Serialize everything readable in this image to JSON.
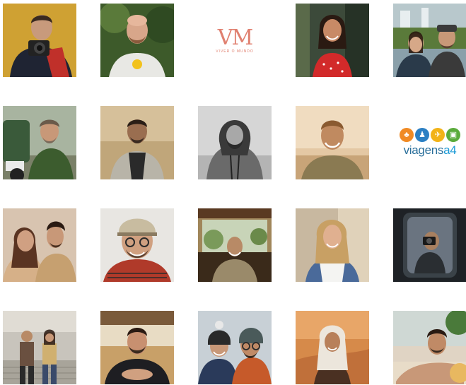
{
  "grid": {
    "tiles": [
      {
        "id": "r1c1",
        "kind": "photo",
        "subject": "photographer with camera"
      },
      {
        "id": "r1c2",
        "kind": "photo",
        "subject": "bald bearded man in white tee"
      },
      {
        "id": "r1c3",
        "kind": "logo",
        "mark": "VM",
        "tagline": "VIVER O MUNDO"
      },
      {
        "id": "r1c4",
        "kind": "photo",
        "subject": "woman in red polka dress"
      },
      {
        "id": "r1c5",
        "kind": "photo",
        "subject": "couple at waterfall"
      },
      {
        "id": "r2c1",
        "kind": "photo",
        "subject": "man on motorbike"
      },
      {
        "id": "r2c2",
        "kind": "photo",
        "subject": "man in grey hoodie"
      },
      {
        "id": "r2c3",
        "kind": "photo",
        "subject": "bearded man in hood, black and white"
      },
      {
        "id": "r2c4",
        "kind": "photo",
        "subject": "smiling man at sunset"
      },
      {
        "id": "r2c5",
        "kind": "logo",
        "text_main": "viagens",
        "text_accent": "a4"
      },
      {
        "id": "r3c1",
        "kind": "photo",
        "subject": "smiling couple"
      },
      {
        "id": "r3c2",
        "kind": "photo",
        "subject": "man with cap and glasses"
      },
      {
        "id": "r3c3",
        "kind": "photo",
        "subject": "man in safari vehicle"
      },
      {
        "id": "r3c4",
        "kind": "photo",
        "subject": "woman in white top"
      },
      {
        "id": "r3c5",
        "kind": "photo",
        "subject": "person with camera in window"
      },
      {
        "id": "r4c1",
        "kind": "photo",
        "subject": "couple on stairs"
      },
      {
        "id": "r4c2",
        "kind": "photo",
        "subject": "man at window"
      },
      {
        "id": "r4c3",
        "kind": "photo",
        "subject": "couple in beanies"
      },
      {
        "id": "r4c4",
        "kind": "photo",
        "subject": "woman in desert"
      },
      {
        "id": "r4c5",
        "kind": "photo",
        "subject": "shirtless man on beach"
      }
    ]
  },
  "colors": {
    "vm_logo": "#e08070",
    "viagens_text": "#2a6f9b",
    "viagens_accent": "#1b9ad6",
    "icon_orange": "#f08a24",
    "icon_blue": "#2b7fc3",
    "icon_yellow": "#f2b318",
    "icon_green": "#5aab3c"
  },
  "icons": [
    "palm-tree-icon",
    "family-icon",
    "airplane-icon",
    "suitcase-icon"
  ]
}
